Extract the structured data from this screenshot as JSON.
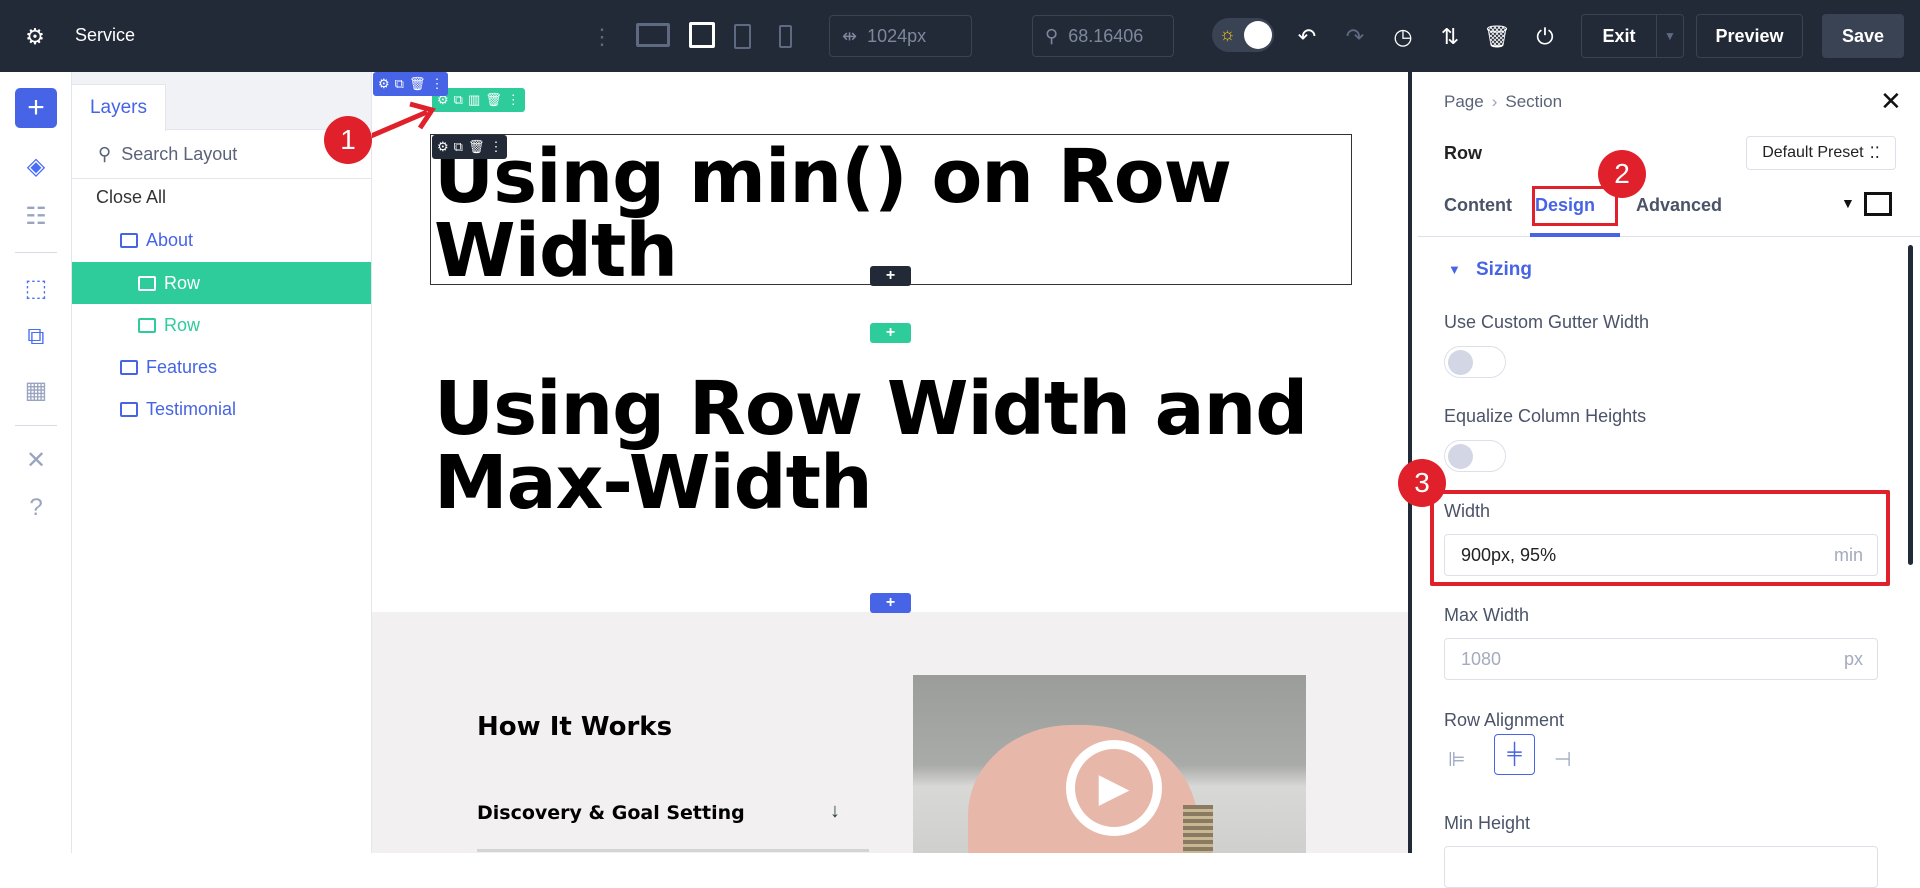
{
  "topbar": {
    "title": "Service",
    "width_value": "1024px",
    "zoom_value": "68.16406",
    "exit": "Exit",
    "preview": "Preview",
    "save": "Save"
  },
  "layers": {
    "tab": "Layers",
    "search_placeholder": "Search Layout",
    "close_all": "Close All",
    "items": [
      {
        "label": "About",
        "type": "section"
      },
      {
        "label": "Row",
        "type": "row",
        "selected": true
      },
      {
        "label": "Row",
        "type": "row"
      },
      {
        "label": "Features",
        "type": "section"
      },
      {
        "label": "Testimonial",
        "type": "section"
      }
    ]
  },
  "canvas": {
    "heading1": "Using min() on Row Width",
    "heading2": "Using Row Width and Max-Width",
    "how_it_works": "How It Works",
    "accordion_item": "Discovery & Goal Setting",
    "plus": "+"
  },
  "annotations": [
    "1",
    "2",
    "3"
  ],
  "panel": {
    "breadcrumb": [
      "Page",
      "Section"
    ],
    "element": "Row",
    "preset": "Default Preset",
    "tabs": [
      "Content",
      "Design",
      "Advanced"
    ],
    "active_tab": "Design",
    "group": "Sizing",
    "fields": {
      "gutter": "Use Custom Gutter Width",
      "equalize": "Equalize Column Heights",
      "width": "Width",
      "width_value": "900px, 95%",
      "width_unit": "min",
      "max_width": "Max Width",
      "max_width_placeholder": "1080",
      "max_width_unit": "px",
      "row_alignment": "Row Alignment",
      "min_height": "Min Height"
    }
  },
  "colors": {
    "accent": "#4664e5",
    "green": "#2ecc9a",
    "dark": "#232a37",
    "red": "#e0202a"
  }
}
